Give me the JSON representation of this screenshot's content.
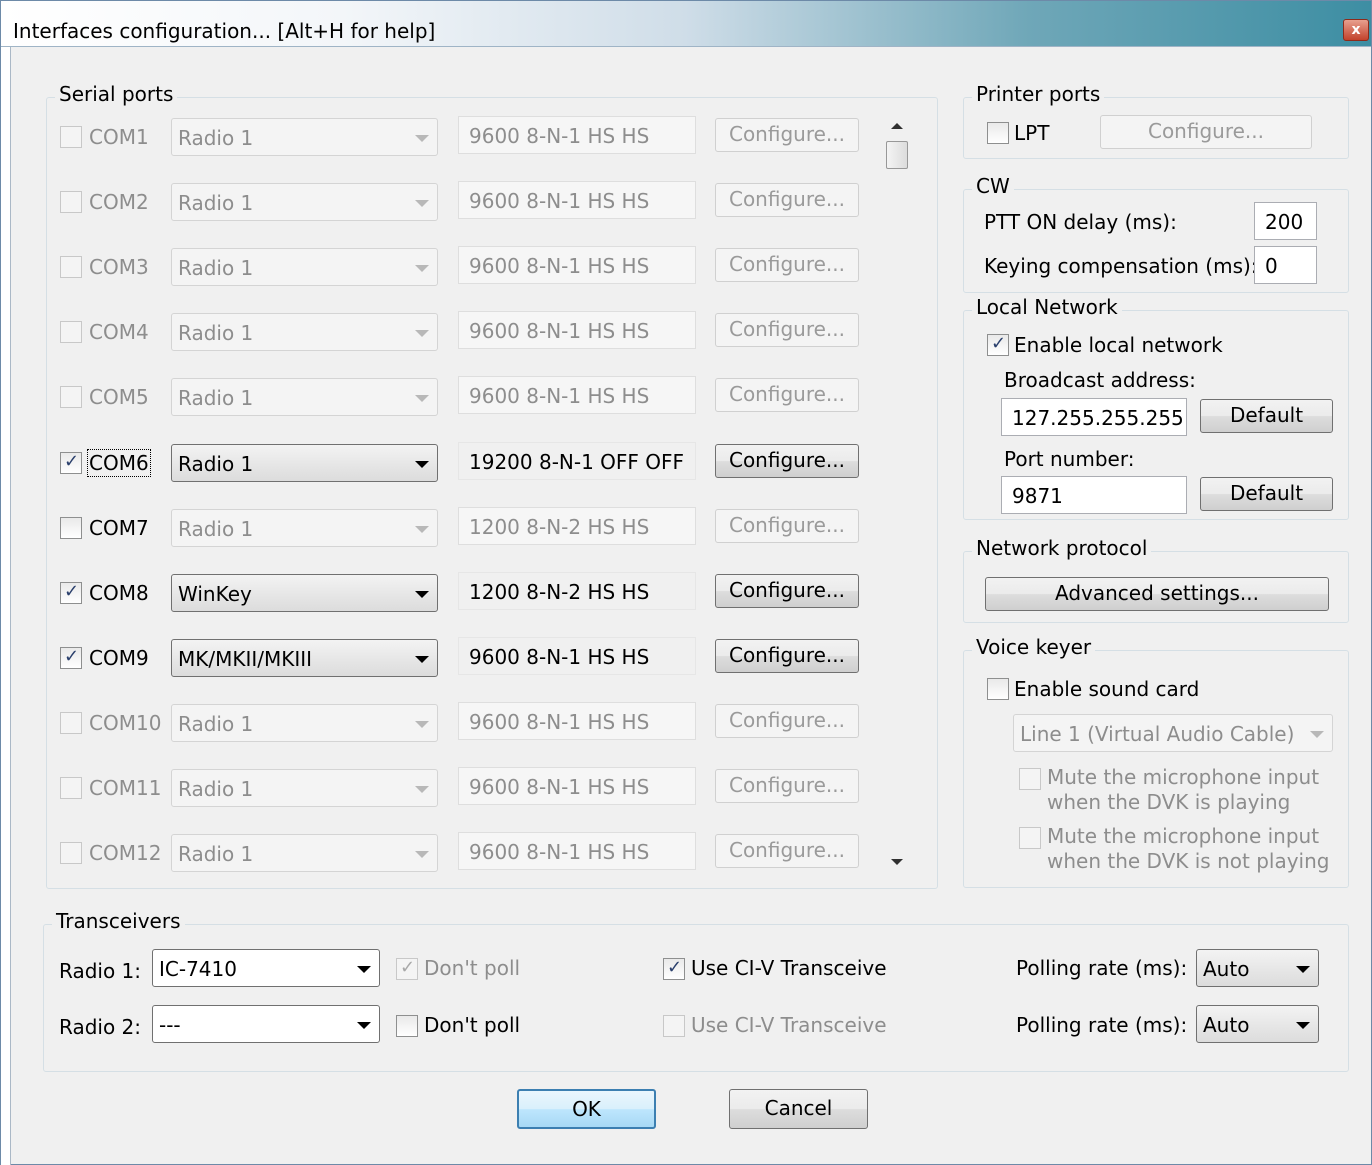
{
  "window": {
    "title": "Interfaces configuration... [Alt+H for help]",
    "close_glyph": "x"
  },
  "serial_ports": {
    "label": "Serial ports",
    "rows": [
      {
        "port": "COM1",
        "checked": false,
        "enabled": false,
        "device": "Radio 1",
        "settings": "9600 8-N-1 HS HS",
        "configure": "Configure..."
      },
      {
        "port": "COM2",
        "checked": false,
        "enabled": false,
        "device": "Radio 1",
        "settings": "9600 8-N-1 HS HS",
        "configure": "Configure..."
      },
      {
        "port": "COM3",
        "checked": false,
        "enabled": false,
        "device": "Radio 1",
        "settings": "9600 8-N-1 HS HS",
        "configure": "Configure..."
      },
      {
        "port": "COM4",
        "checked": false,
        "enabled": false,
        "device": "Radio 1",
        "settings": "9600 8-N-1 HS HS",
        "configure": "Configure..."
      },
      {
        "port": "COM5",
        "checked": false,
        "enabled": false,
        "device": "Radio 1",
        "settings": "9600 8-N-1 HS HS",
        "configure": "Configure..."
      },
      {
        "port": "COM6",
        "checked": true,
        "enabled": true,
        "device": "Radio 1",
        "settings": "19200 8-N-1 OFF OFF",
        "configure": "Configure..."
      },
      {
        "port": "COM7",
        "checked": false,
        "enabled": true,
        "device": "Radio 1",
        "settings": "1200 8-N-2 HS HS",
        "configure": "Configure..."
      },
      {
        "port": "COM8",
        "checked": true,
        "enabled": true,
        "device": "WinKey",
        "settings": "1200 8-N-2 HS HS",
        "configure": "Configure..."
      },
      {
        "port": "COM9",
        "checked": true,
        "enabled": true,
        "device": "MK/MKII/MKIII",
        "settings": "9600 8-N-1 HS HS",
        "configure": "Configure..."
      },
      {
        "port": "COM10",
        "checked": false,
        "enabled": false,
        "device": "Radio 1",
        "settings": "9600 8-N-1 HS HS",
        "configure": "Configure..."
      },
      {
        "port": "COM11",
        "checked": false,
        "enabled": false,
        "device": "Radio 1",
        "settings": "9600 8-N-1 HS HS",
        "configure": "Configure..."
      },
      {
        "port": "COM12",
        "checked": false,
        "enabled": false,
        "device": "Radio 1",
        "settings": "9600 8-N-1 HS HS",
        "configure": "Configure..."
      }
    ]
  },
  "printer_ports": {
    "label": "Printer ports",
    "lpt_label": "LPT",
    "lpt_checked": false,
    "configure": "Configure..."
  },
  "cw": {
    "label": "CW",
    "ptt_label": "PTT ON delay (ms):",
    "ptt_value": "200",
    "keying_label": "Keying compensation (ms):",
    "keying_value": "0"
  },
  "local_network": {
    "label": "Local Network",
    "enable_label": "Enable local network",
    "enable_checked": true,
    "broadcast_label": "Broadcast address:",
    "broadcast_value": "127.255.255.255",
    "broadcast_default": "Default",
    "port_label": "Port number:",
    "port_value": "9871",
    "port_default": "Default"
  },
  "network_protocol": {
    "label": "Network protocol",
    "advanced": "Advanced settings..."
  },
  "voice_keyer": {
    "label": "Voice keyer",
    "enable_label": "Enable sound card",
    "enable_checked": false,
    "device": "Line 1 (Virtual Audio Cable)",
    "mute_playing_1": "Mute the microphone input",
    "mute_playing_2": "when the DVK is playing",
    "mute_notplaying_1": "Mute the microphone input",
    "mute_notplaying_2": "when the DVK is not playing"
  },
  "transceivers": {
    "label": "Transceivers",
    "radio1_label": "Radio 1:",
    "radio1_value": "IC-7410",
    "radio1_dontpoll": "Don't poll",
    "radio1_civ": "Use CI-V Transceive",
    "radio1_polling_label": "Polling rate (ms):",
    "radio1_polling_value": "Auto",
    "radio2_label": "Radio 2:",
    "radio2_value": "---",
    "radio2_dontpoll": "Don't poll",
    "radio2_civ": "Use CI-V Transceive",
    "radio2_polling_label": "Polling rate (ms):",
    "radio2_polling_value": "Auto"
  },
  "buttons": {
    "ok": "OK",
    "cancel": "Cancel"
  }
}
